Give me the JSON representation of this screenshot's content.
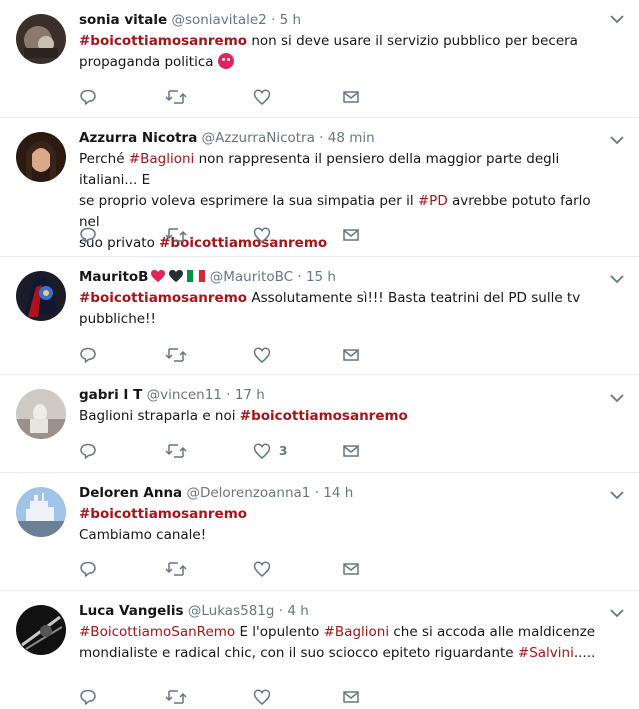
{
  "tweets": [
    {
      "name": "sonia vitale",
      "handle": "@soniavitale2",
      "dot": "·",
      "time": "5 h",
      "line1_tag": "#boicottiamosanremo",
      "line1_text": " non si deve usare il servizio pubblico per becera",
      "line2_text": "propaganda politica",
      "emoji": "angry-face"
    },
    {
      "name": "Azzurra Nicotra",
      "handle": "@AzzurraNicotra",
      "dot": "·",
      "time": "48 min",
      "line1_pre": "Perché ",
      "line1_tag": "#Baglioni",
      "line1_text": " non rappresenta il pensiero della maggior parte degli italiani... E",
      "line2_pre": "se proprio voleva esprimere la sua simpatia per il ",
      "line2_tag": "#PD",
      "line2_text": " avrebbe potuto farlo nel",
      "line3_pre": "suo privato ",
      "line3_tag": "#boicottiamosanremo"
    },
    {
      "name": "MauritoB",
      "handle": "@MauritoBC",
      "dot": "·",
      "time": "15 h",
      "line1_tag": "#boicottiamosanremo",
      "line1_text": " Assolutamente sì!!! Basta teatrini del PD sulle tv",
      "line2_text": "pubbliche!!"
    },
    {
      "name": "gabri I T",
      "handle": "@vincen11",
      "dot": "·",
      "time": "17 h",
      "line1_pre": "Baglioni straparla e noi ",
      "line1_tag": "#boicottiamosanremo",
      "like_count": "3"
    },
    {
      "name": "Deloren Anna",
      "handle": "@Delorenzoanna1",
      "dot": "·",
      "time": "14 h",
      "line1_tag": "#boicottiamosanremo",
      "line2_text": "Cambiamo canale!"
    },
    {
      "name": "Luca Vangelis",
      "handle": "@Lukas581g",
      "dot": "·",
      "time": "4 h",
      "line1_tag": "#BoicottiamoSanRemo",
      "line1_text": " E l'opulento ",
      "line1_tag2": "#Baglioni",
      "line1_text2": " che si accoda alle maldicenze",
      "line2_pre": "mondialiste e radical chic, con il suo sciocco epiteto riguardante ",
      "line2_tag": "#Salvini",
      "line2_text": "....."
    }
  ],
  "colors": {
    "hashtag": "#a4161a",
    "secondary_text": "#657786",
    "divider": "#e6ecf0"
  },
  "icons": [
    "reply-icon",
    "retweet-icon",
    "like-icon",
    "direct-message-icon",
    "chevron-down-icon"
  ]
}
